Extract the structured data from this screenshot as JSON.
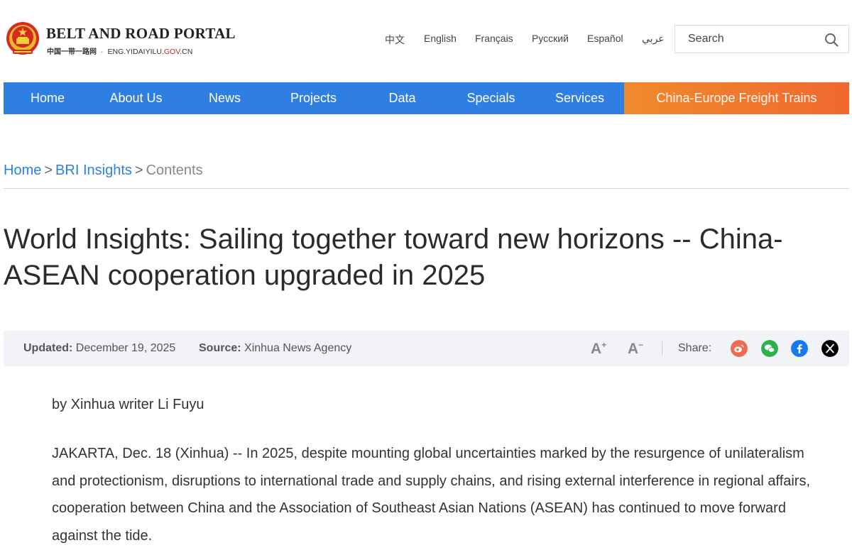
{
  "header": {
    "title": "BELT AND ROAD PORTAL",
    "subtitle_cn": "中国一带一路网",
    "domain_prefix": "ENG.YIDAIYILU.",
    "domain_gov": "GOV",
    "domain_suffix": ".CN",
    "languages": [
      "中文",
      "English",
      "Français",
      "Русский",
      "Español",
      "عربي"
    ],
    "search": {
      "placeholder": "Search"
    }
  },
  "nav": {
    "items": [
      "Home",
      "About Us",
      "News",
      "Projects",
      "Data",
      "Specials",
      "Services"
    ],
    "special": "China-Europe Freight Trains",
    "colors": {
      "primary": "#2f7fe3",
      "special_from": "#f08a2c",
      "special_to": "#f0682e"
    }
  },
  "breadcrumb": {
    "items": [
      "Home",
      "BRI Insights",
      "Contents"
    ],
    "separator": ">"
  },
  "article": {
    "title": "World Insights: Sailing together toward new horizons -- China-ASEAN cooperation upgraded in 2025",
    "meta": {
      "updated_label": "Updated:",
      "updated_value": "December 19, 2025",
      "source_label": "Source:",
      "source_value": "Xinhua News Agency",
      "font_increase": "A",
      "font_increase_sup": "+",
      "font_decrease": "A",
      "font_decrease_sup": "−",
      "share_label": "Share:",
      "share_icons": [
        "weibo-icon",
        "wechat-icon",
        "facebook-icon",
        "x-icon"
      ]
    },
    "byline": "by Xinhua writer Li Fuyu",
    "paragraphs": [
      "JAKARTA, Dec. 18 (Xinhua) -- In 2025, despite mounting global uncertainties marked by the resurgence of unilateralism and protectionism, disruptions to international trade and supply chains, and rising external interference in regional affairs, cooperation between China and the Association of Southeast Asian Nations (ASEAN) has continued to move forward against the tide."
    ]
  }
}
